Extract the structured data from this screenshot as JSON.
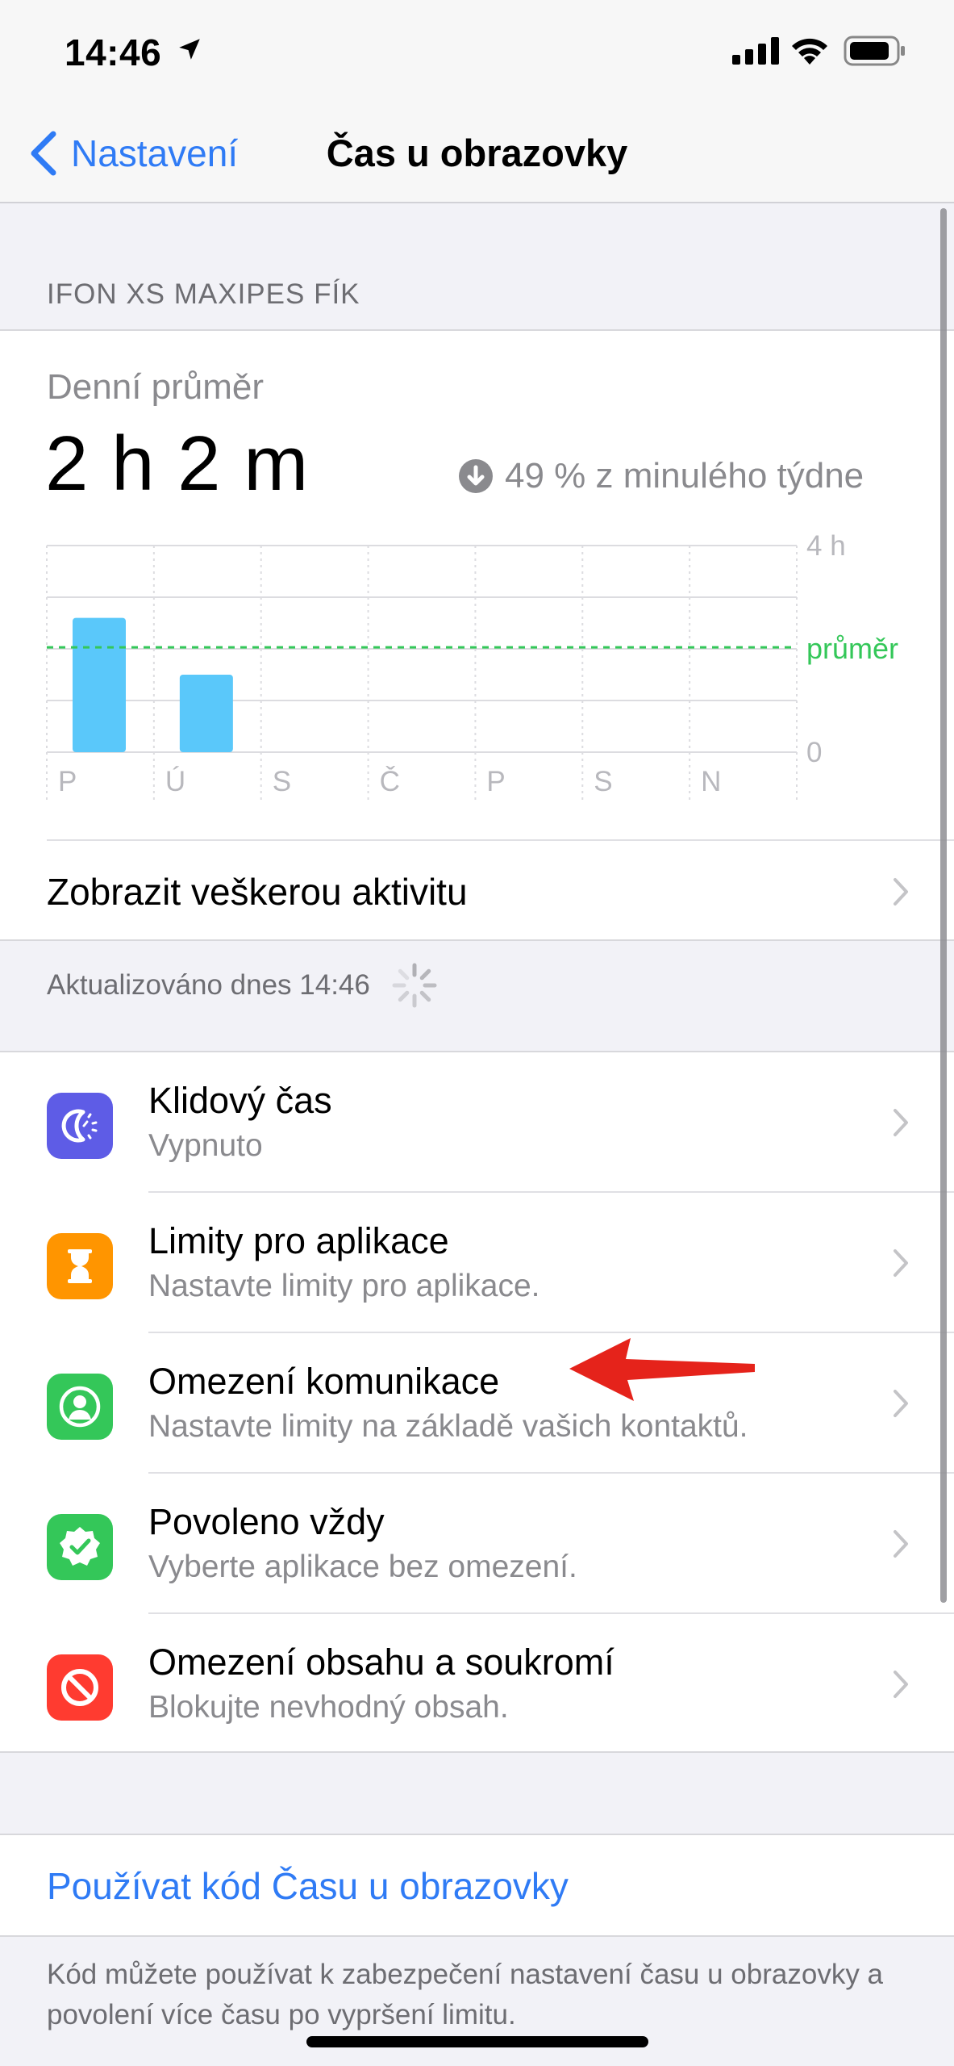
{
  "status_bar": {
    "time": "14:46",
    "icons": [
      "location-arrow-icon",
      "cellular-signal-icon",
      "wifi-icon",
      "battery-icon"
    ]
  },
  "nav": {
    "back_label": "Nastavení",
    "title": "Čas u obrazovky"
  },
  "device_header": "IFON XS MAXIPES FÍK",
  "summary": {
    "avg_label": "Denní průměr",
    "avg_value": "2 h 2 m",
    "change_text": "49 % z minulého týdne",
    "change_icon": "arrow-down-circle-icon"
  },
  "chart_data": {
    "type": "bar",
    "categories": [
      "P",
      "Ú",
      "S",
      "Č",
      "P",
      "S",
      "N"
    ],
    "values": [
      2.6,
      1.5,
      0,
      0,
      0,
      0,
      0
    ],
    "average": 2.03,
    "ylim": [
      0,
      4
    ],
    "y_tick_labels": [
      "4 h",
      "0"
    ],
    "average_label": "průměr",
    "colors": {
      "bar": "#5ac8fa",
      "average": "#34c759",
      "grid": "#dcdce0",
      "label": "#b8b8bd"
    }
  },
  "activity_link": "Zobrazit veškerou aktivitu",
  "updated_label": "Aktualizováno dnes 14:46",
  "settings": [
    {
      "title": "Klidový čas",
      "subtitle": "Vypnuto",
      "icon": "downtime-icon",
      "color": "#5e5ce6"
    },
    {
      "title": "Limity pro aplikace",
      "subtitle": "Nastavte limity pro aplikace.",
      "icon": "hourglass-icon",
      "color": "#ff9500"
    },
    {
      "title": "Omezení komunikace",
      "subtitle": "Nastavte limity na základě vašich kontaktů.",
      "icon": "contact-icon",
      "color": "#34c759"
    },
    {
      "title": "Povoleno vždy",
      "subtitle": "Vyberte aplikace bez omezení.",
      "icon": "checkmark-seal-icon",
      "color": "#34c759"
    },
    {
      "title": "Omezení obsahu a soukromí",
      "subtitle": "Blokujte nevhodný obsah.",
      "icon": "prohibited-icon",
      "color": "#ff3b30"
    }
  ],
  "annotation_color": "#e5231b",
  "passcode_link": "Používat kód Času u obrazovky",
  "footer_note": "Kód můžete používat k zabezpečení nastavení času u obrazovky a povolení více času po vypršení limitu."
}
